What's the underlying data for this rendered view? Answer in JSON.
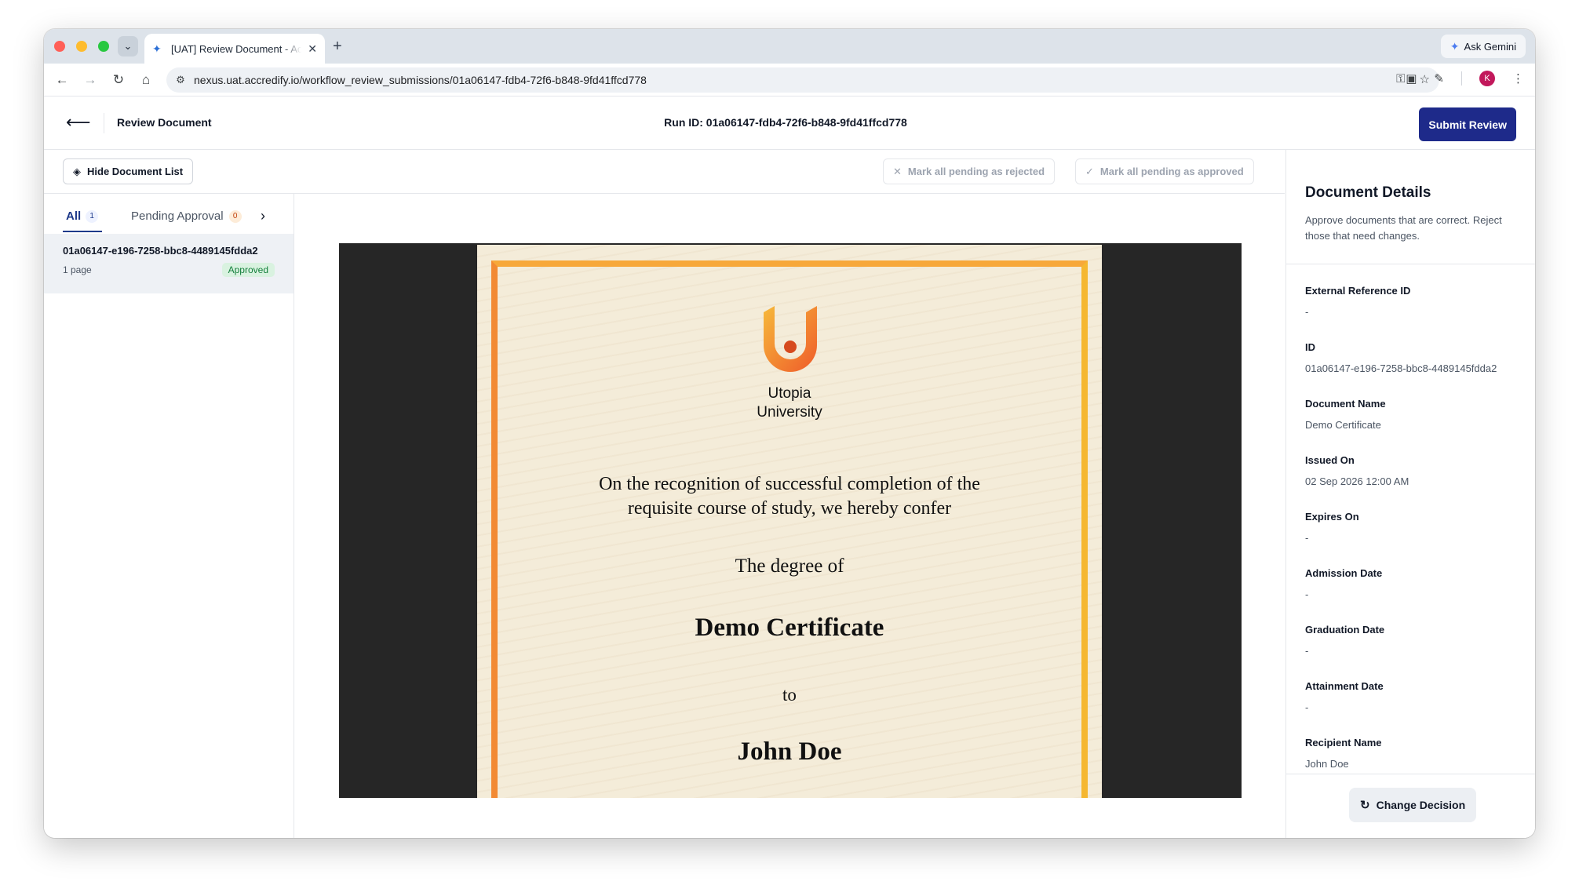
{
  "browser": {
    "tab_title": "[UAT] Review Document - Accredify",
    "url": "nexus.uat.accredify.io/workflow_review_submissions/01a06147-fdb4-72f6-b848-9fd41ffcd778",
    "ask_gemini": "Ask Gemini",
    "profile_initial": "K",
    "icons": [
      "tab-search-icon",
      "close-icon",
      "plus-icon",
      "back-icon",
      "forward-icon",
      "reload-icon",
      "home-icon",
      "site-info-icon",
      "password-key-icon",
      "star-icon",
      "screenshot-icon",
      "extensions-icon",
      "more-icon"
    ]
  },
  "header": {
    "title": "Review Document",
    "run_id": "Run ID: 01a06147-fdb4-72f6-b848-9fd41ffcd778",
    "submit_label": "Submit Review"
  },
  "toolbar": {
    "hide_list_label": "Hide Document List",
    "mark_rejected_label": "Mark all pending as rejected",
    "mark_approved_label": "Mark all pending as approved"
  },
  "sidebar": {
    "tabs": [
      {
        "label": "All",
        "count": "1"
      },
      {
        "label": "Pending Approval",
        "count": "0"
      }
    ],
    "documents": [
      {
        "id": "01a06147-e196-7258-bbc8-4489145fdda2",
        "pages": "1 page",
        "status": "Approved"
      }
    ]
  },
  "certificate": {
    "university_line1": "Utopia",
    "university_line2": "University",
    "body_line1": "On the recognition of successful completion of the",
    "body_line2": "requisite course of study, we hereby confer",
    "degree_of": "The degree of",
    "title": "Demo Certificate",
    "to": "to",
    "recipient": "John Doe"
  },
  "details": {
    "title": "Document Details",
    "description": "Approve documents that are correct. Reject those that need changes.",
    "fields": [
      {
        "label": "External Reference ID",
        "value": "-"
      },
      {
        "label": "ID",
        "value": "01a06147-e196-7258-bbc8-4489145fdda2"
      },
      {
        "label": "Document Name",
        "value": "Demo Certificate"
      },
      {
        "label": "Issued On",
        "value": "02 Sep 2026 12:00 AM"
      },
      {
        "label": "Expires On",
        "value": "-"
      },
      {
        "label": "Admission Date",
        "value": "-"
      },
      {
        "label": "Graduation Date",
        "value": "-"
      },
      {
        "label": "Attainment Date",
        "value": "-"
      },
      {
        "label": "Recipient Name",
        "value": "John Doe"
      }
    ],
    "change_decision_label": "Change Decision"
  },
  "colors": {
    "primary": "#1e2a8a",
    "approved_text": "#15803d",
    "approved_bg": "#d9f2e0",
    "pending_badge": "#c2410c",
    "certificate_border": "#f5b731"
  }
}
